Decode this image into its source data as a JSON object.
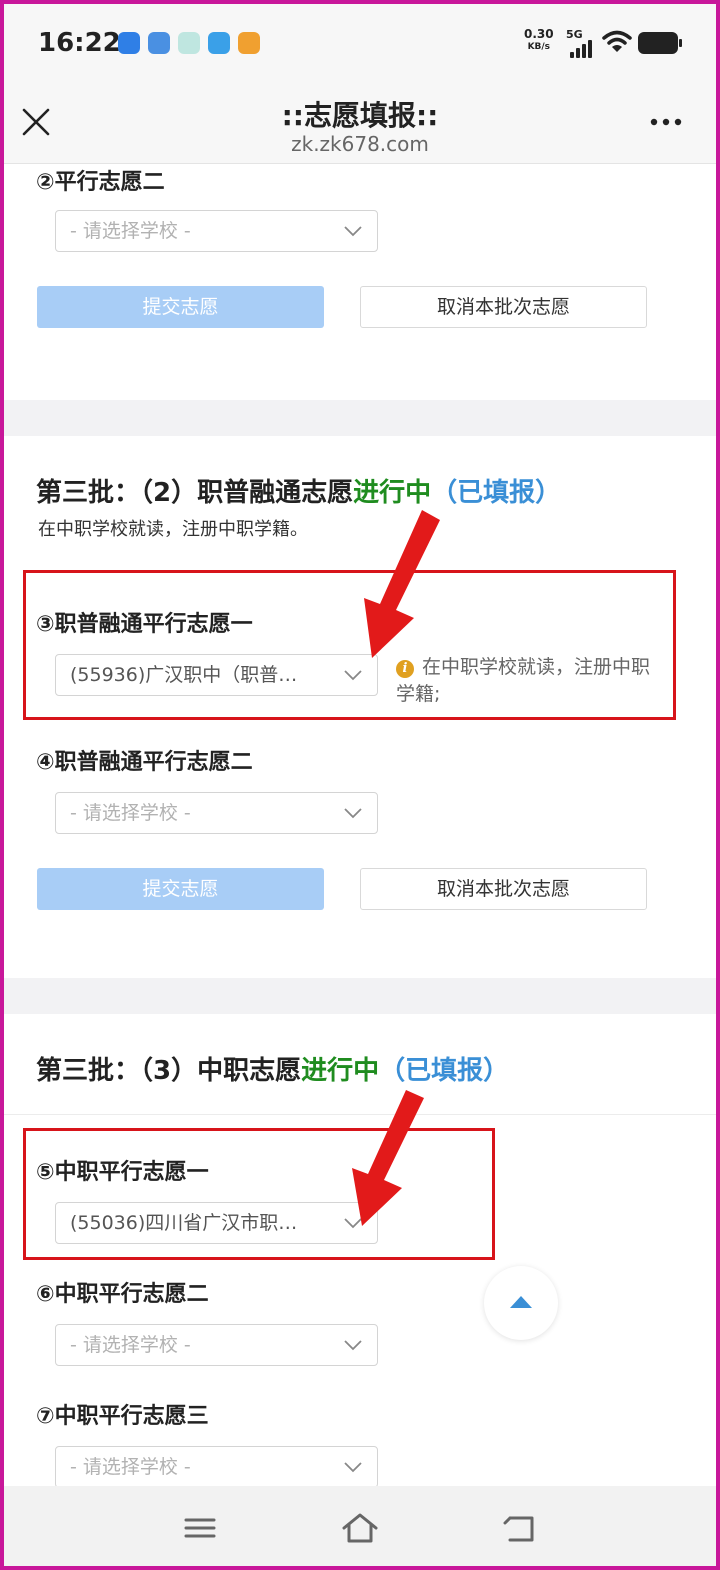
{
  "status_bar": {
    "time": "16:22",
    "net_speed_value": "0.30",
    "net_speed_unit": "KB/s",
    "network_type": "5G"
  },
  "header": {
    "title": "::志愿填报::",
    "url": "zk.zk678.com"
  },
  "batch2_tail": {
    "field_label": "②平行志愿二",
    "select_placeholder": "- 请选择学校 -",
    "submit_label": "提交志愿",
    "cancel_label": "取消本批次志愿"
  },
  "batch3_2": {
    "title_main": "第三批：（2）职普融通志愿",
    "title_status": "进行中",
    "title_filled": "（已填报）",
    "description": "在中职学校就读，注册中职学籍。",
    "field1_label": "③职普融通平行志愿一",
    "field1_value": "(55936)广汉职中（职普…",
    "field1_hint": "在中职学校就读，注册中职学籍;",
    "field2_label": "④职普融通平行志愿二",
    "field2_placeholder": "- 请选择学校 -",
    "submit_label": "提交志愿",
    "cancel_label": "取消本批次志愿"
  },
  "batch3_3": {
    "title_main": "第三批：（3）中职志愿",
    "title_status": "进行中",
    "title_filled": "（已填报）",
    "field1_label": "⑤中职平行志愿一",
    "field1_value": "(55036)四川省广汉市职…",
    "field2_label": "⑥中职平行志愿二",
    "field2_placeholder": "- 请选择学校 -",
    "field3_label": "⑦中职平行志愿三",
    "field3_placeholder": "- 请选择学校 -"
  },
  "colors": {
    "status_green": "#1f8c1f",
    "filled_blue": "#3a8fd6",
    "primary_button": "#a8cdf6",
    "highlight_red": "#d7141a",
    "frame_magenta": "#c8179a"
  }
}
